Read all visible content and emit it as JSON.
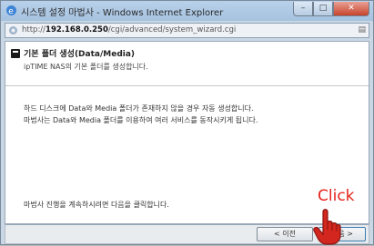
{
  "window": {
    "title": "시스템 설정 마법사 - Windows Internet Explorer"
  },
  "address": {
    "url_prefix": "http://",
    "url_host": "192.168.0.250",
    "url_path": "/cgi/advanced/system_wizard.cgi"
  },
  "page": {
    "title": "기본 폴더 생성(Data/Media)",
    "subtitle": "ipTIME NAS의 기본 폴더를 생성합니다.",
    "desc_line1": "하드 디스크에 Data와 Media 폴더가 존재하지 않을 경우 자동 생성합니다.",
    "desc_line2": "마법사는 Data와 Media 폴더를 이용하여 여러 서비스를 동작시키게 됩니다.",
    "proceed_text": "마법사 진행을 계속하시려면 다음을 클릭합니다."
  },
  "buttons": {
    "prev_label": "< 이전",
    "next_label": "다음 >"
  },
  "annotation": {
    "click_label": "Click"
  },
  "colors": {
    "annotation_red": "#e5221b",
    "titlebar": "#b9d1ea"
  },
  "icons": [
    "ie-icon",
    "minimize-icon",
    "maximize-icon",
    "close-icon",
    "page-icon",
    "folder-title-icon",
    "pointing-hand-icon"
  ]
}
